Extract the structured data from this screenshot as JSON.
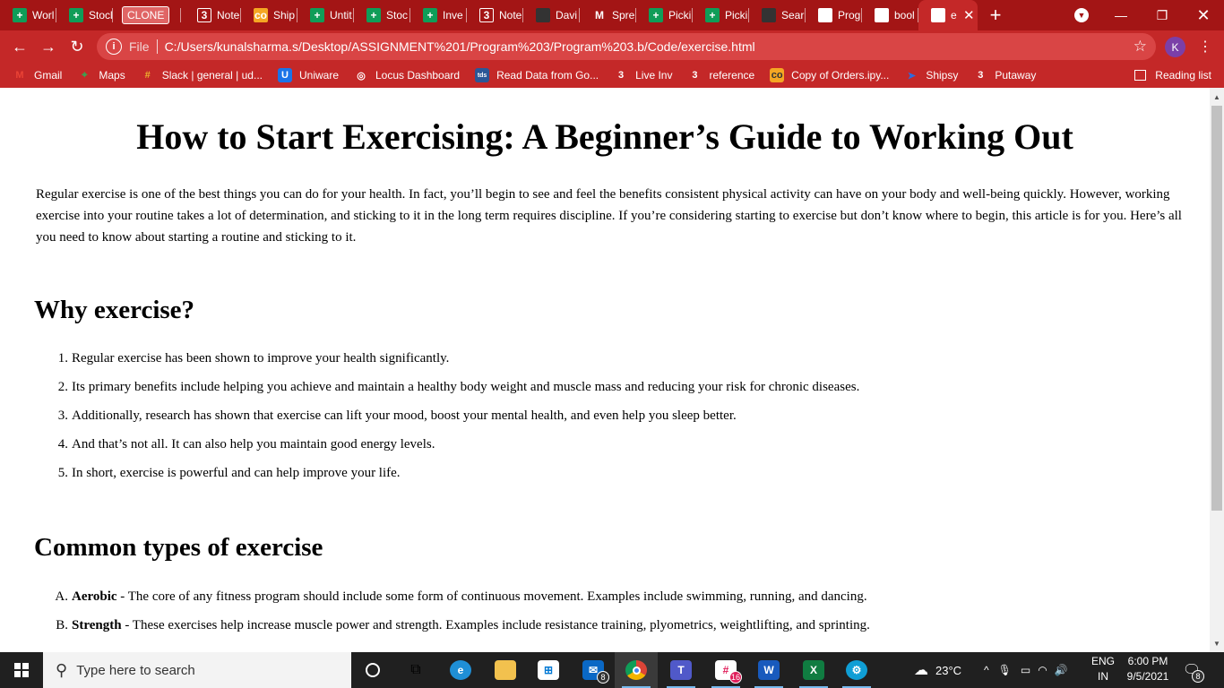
{
  "tabs": [
    {
      "label": "Worl",
      "icon": "sheets-icon"
    },
    {
      "label": "Stocl",
      "icon": "sheets-icon"
    },
    {
      "label": "CLONE",
      "icon": "clone-badge"
    },
    {
      "label": "Note",
      "icon": "notebook-icon"
    },
    {
      "label": "Ship",
      "icon": "colab-icon"
    },
    {
      "label": "Untit",
      "icon": "sheets-icon"
    },
    {
      "label": "Stoc",
      "icon": "sheets-icon"
    },
    {
      "label": "Inve",
      "icon": "sheets-icon"
    },
    {
      "label": "Note",
      "icon": "notebook-icon"
    },
    {
      "label": "Davi",
      "icon": "github-icon"
    },
    {
      "label": "Spre",
      "icon": "gmail-icon"
    },
    {
      "label": "Picki",
      "icon": "sheets-icon"
    },
    {
      "label": "Picki",
      "icon": "sheets-icon"
    },
    {
      "label": "Sear",
      "icon": "github-icon"
    },
    {
      "label": "Prog",
      "icon": "globe-icon"
    },
    {
      "label": "bool",
      "icon": "globe-icon"
    },
    {
      "label": "e",
      "icon": "globe-icon"
    }
  ],
  "address": {
    "scheme_label": "File",
    "url": "C:/Users/kunalsharma.s/Desktop/ASSIGNMENT%201/Program%203/Program%203.b/Code/exercise.html"
  },
  "profile_initial": "K",
  "bookmarks": [
    {
      "label": "Gmail",
      "icon": "gmail-icon"
    },
    {
      "label": "Maps",
      "icon": "maps-icon"
    },
    {
      "label": "Slack | general | ud...",
      "icon": "slack-icon"
    },
    {
      "label": "Uniware",
      "icon": "uniware-icon"
    },
    {
      "label": "Locus Dashboard",
      "icon": "locus-icon"
    },
    {
      "label": "Read Data from Go...",
      "icon": "tds-icon"
    },
    {
      "label": "Live Inv",
      "icon": "notebook-icon"
    },
    {
      "label": "reference",
      "icon": "notebook-icon"
    },
    {
      "label": "Copy of Orders.ipy...",
      "icon": "colab-icon"
    },
    {
      "label": "Shipsy",
      "icon": "shipsy-icon"
    },
    {
      "label": "Putaway",
      "icon": "notebook-icon"
    }
  ],
  "reading_list": "Reading list",
  "page": {
    "title": "How to Start Exercising: A Beginner’s Guide to Working Out",
    "intro": "Regular exercise is one of the best things you can do for your health. In fact, you’ll begin to see and feel the benefits consistent physical activity can have on your body and well-being quickly. However, working exercise into your routine takes a lot of determination, and sticking to it in the long term requires discipline. If you’re considering starting to exercise but don’t know where to begin, this article is for you. Here’s all you need to know about starting a routine and sticking to it.",
    "why_heading": "Why exercise?",
    "why_items": [
      {
        "marker": "1.",
        "text": "Regular exercise has been shown to improve your health significantly."
      },
      {
        "marker": "2.",
        "text": "Its primary benefits include helping you achieve and maintain a healthy body weight and muscle mass and reducing your risk for chronic diseases."
      },
      {
        "marker": "3.",
        "text": "Additionally, research has shown that exercise can lift your mood, boost your mental health, and even help you sleep better."
      },
      {
        "marker": "4.",
        "text": "And that’s not all. It can also help you maintain good energy levels."
      },
      {
        "marker": "5.",
        "text": "In short, exercise is powerful and can help improve your life."
      }
    ],
    "types_heading": "Common types of exercise",
    "types_items": [
      {
        "marker": "A.",
        "term": "Aerobic",
        "text": " - The core of any fitness program should include some form of continuous movement. Examples include swimming, running, and dancing."
      },
      {
        "marker": "B.",
        "term": "Strength",
        "text": " - These exercises help increase muscle power and strength. Examples include resistance training, plyometrics, weightlifting, and sprinting."
      }
    ]
  },
  "taskbar": {
    "search_placeholder": "Type here to search",
    "mail_badge": "8",
    "slack_badge": "16",
    "weather": "23°C",
    "lang_top": "ENG",
    "lang_bottom": "IN",
    "time": "6:00 PM",
    "date": "9/5/2021",
    "notif_count": "8"
  },
  "colors": {
    "tabstrip": "#a31515",
    "toolbar": "#c42828",
    "taskbar": "#202020"
  }
}
